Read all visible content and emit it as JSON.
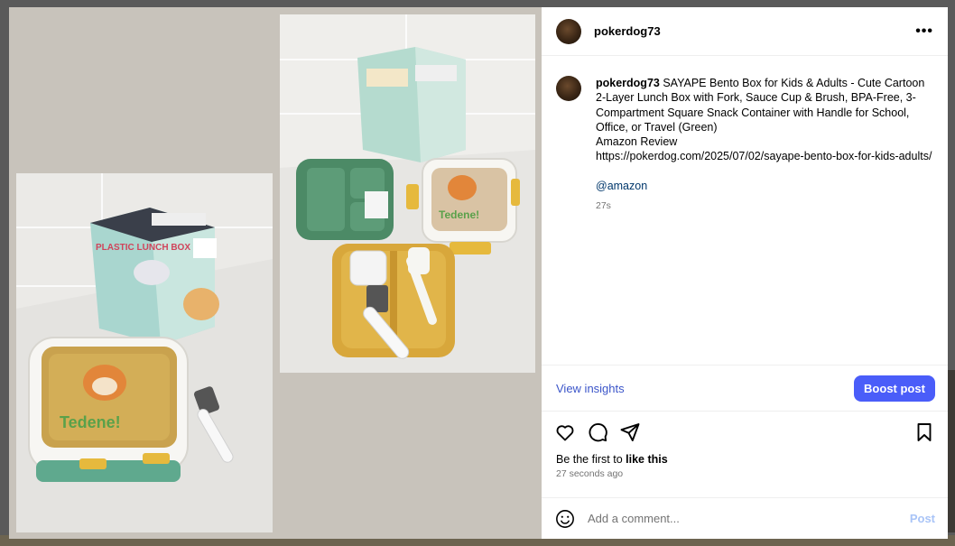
{
  "post": {
    "username": "pokerdog73",
    "caption_username": "pokerdog73",
    "caption_lines": [
      "SAYAPE Bento Box for Kids & Adults - Cute Cartoon 2-Layer Lunch Box with Fork, Sauce Cup & Brush, BPA-Free, 3-Compartment Square Snack Container with Handle for School, Office, or Travel (Green)",
      "Amazon Review",
      "https://pokerdog.com/2025/07/02/sayape-bento-box-for-kids-adults/"
    ],
    "mention": "@amazon",
    "caption_time": "27s",
    "more_icon_label": "•••"
  },
  "insights": {
    "view_label": "View insights",
    "boost_label": "Boost post"
  },
  "icons": {
    "like": "heart-icon",
    "comment": "comment-icon",
    "share": "send-icon",
    "save": "bookmark-icon",
    "emoji": "emoji-icon",
    "more": "more-options-icon"
  },
  "likes": {
    "prefix": "Be the first to ",
    "action": "like this",
    "time_ago": "27 seconds ago"
  },
  "comment": {
    "placeholder": "Add a comment...",
    "post_label": "Post"
  },
  "media": {
    "left_photo_text": {
      "box_title": "PLASTIC LUNCH BOX",
      "lid_text": "Tedene!"
    },
    "right_photo_text": {
      "lid_text": "Tedene!"
    }
  },
  "colors": {
    "accent": "#4a5df9",
    "link": "#3b55c9",
    "post_disabled": "#a9c4f7"
  }
}
